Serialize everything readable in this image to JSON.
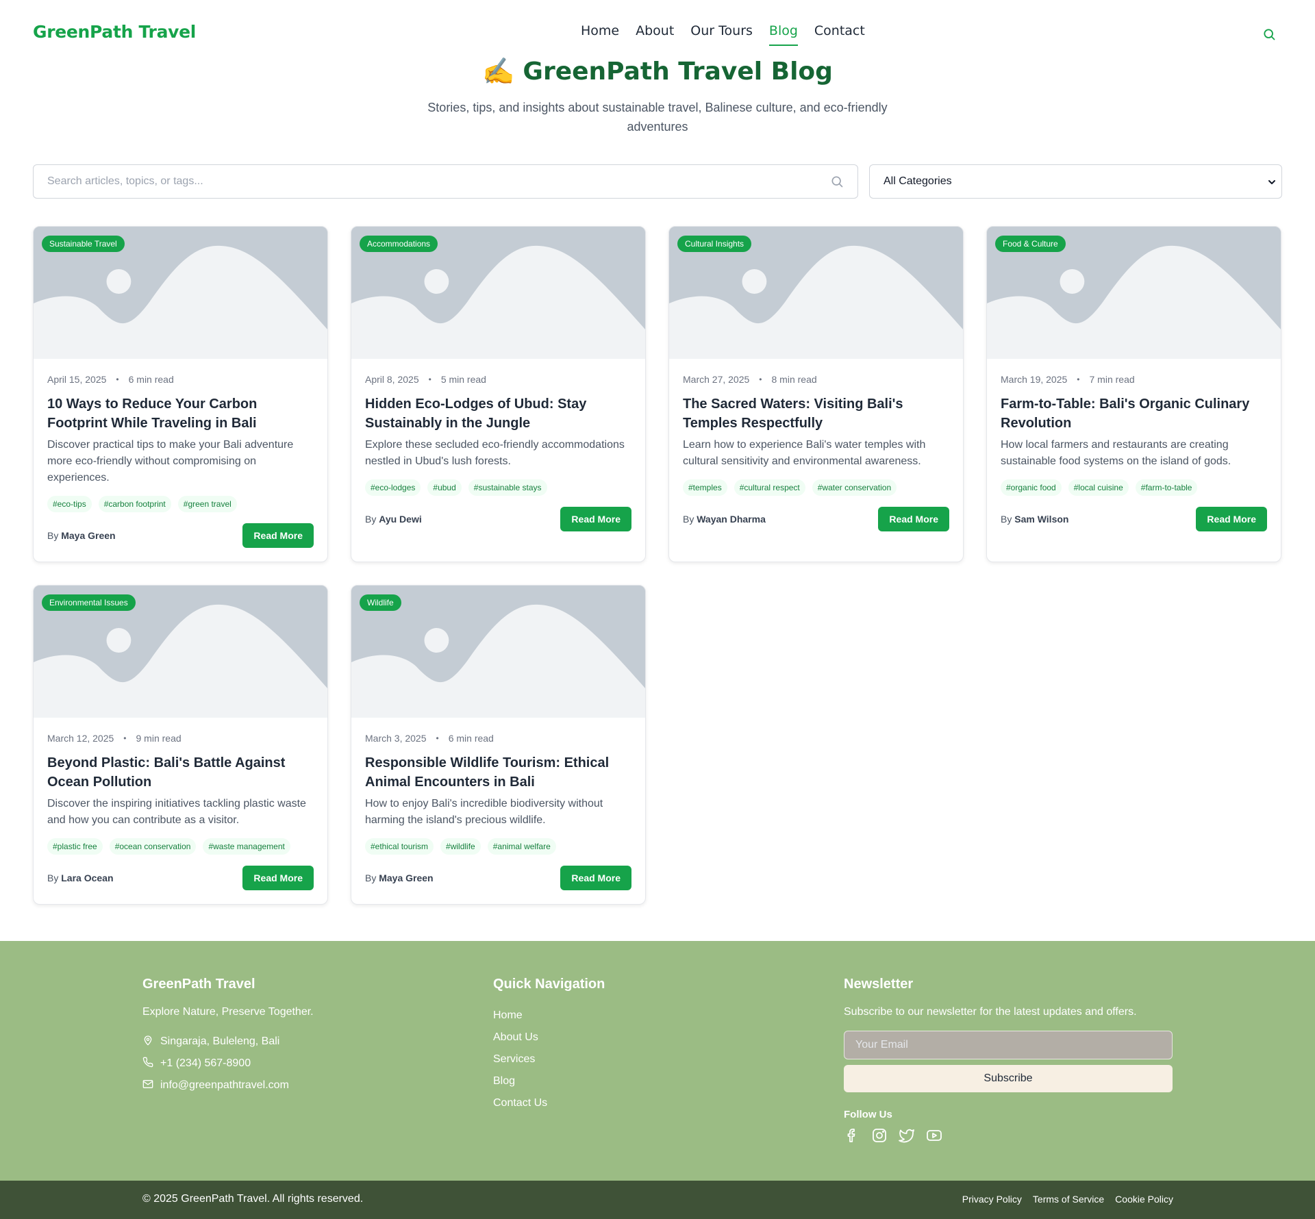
{
  "header": {
    "logo": "GreenPath Travel",
    "nav": [
      "Home",
      "About",
      "Our Tours",
      "Blog",
      "Contact"
    ],
    "active_nav": "Blog"
  },
  "hero": {
    "emoji": "✍️",
    "title": "GreenPath Travel Blog",
    "subtitle": "Stories, tips, and insights about sustainable travel, Balinese culture, and eco-friendly adventures"
  },
  "filters": {
    "search_placeholder": "Search articles, topics, or tags...",
    "category_selected": "All Categories"
  },
  "posts": [
    {
      "category": "Sustainable Travel",
      "date": "April 15, 2025",
      "read_time": "6 min read",
      "title": "10 Ways to Reduce Your Carbon Footprint While Traveling in Bali",
      "excerpt": "Discover practical tips to make your Bali adventure more eco-friendly without compromising on experiences.",
      "tags": [
        "#eco-tips",
        "#carbon footprint",
        "#green travel"
      ],
      "by": "By",
      "author": "Maya Green",
      "cta": "Read More"
    },
    {
      "category": "Accommodations",
      "date": "April 8, 2025",
      "read_time": "5 min read",
      "title": "Hidden Eco-Lodges of Ubud: Stay Sustainably in the Jungle",
      "excerpt": "Explore these secluded eco-friendly accommodations nestled in Ubud's lush forests.",
      "tags": [
        "#eco-lodges",
        "#ubud",
        "#sustainable stays"
      ],
      "by": "By",
      "author": "Ayu Dewi",
      "cta": "Read More"
    },
    {
      "category": "Cultural Insights",
      "date": "March 27, 2025",
      "read_time": "8 min read",
      "title": "The Sacred Waters: Visiting Bali's Temples Respectfully",
      "excerpt": "Learn how to experience Bali's water temples with cultural sensitivity and environmental awareness.",
      "tags": [
        "#temples",
        "#cultural respect",
        "#water conservation"
      ],
      "by": "By",
      "author": "Wayan Dharma",
      "cta": "Read More"
    },
    {
      "category": "Food & Culture",
      "date": "March 19, 2025",
      "read_time": "7 min read",
      "title": "Farm-to-Table: Bali's Organic Culinary Revolution",
      "excerpt": "How local farmers and restaurants are creating sustainable food systems on the island of gods.",
      "tags": [
        "#organic food",
        "#local cuisine",
        "#farm-to-table"
      ],
      "by": "By",
      "author": "Sam Wilson",
      "cta": "Read More"
    },
    {
      "category": "Environmental Issues",
      "date": "March 12, 2025",
      "read_time": "9 min read",
      "title": "Beyond Plastic: Bali's Battle Against Ocean Pollution",
      "excerpt": "Discover the inspiring initiatives tackling plastic waste and how you can contribute as a visitor.",
      "tags": [
        "#plastic free",
        "#ocean conservation",
        "#waste management"
      ],
      "by": "By",
      "author": "Lara Ocean",
      "cta": "Read More"
    },
    {
      "category": "Wildlife",
      "date": "March 3, 2025",
      "read_time": "6 min read",
      "title": "Responsible Wildlife Tourism: Ethical Animal Encounters in Bali",
      "excerpt": "How to enjoy Bali's incredible biodiversity without harming the island's precious wildlife.",
      "tags": [
        "#ethical tourism",
        "#wildlife",
        "#animal welfare"
      ],
      "by": "By",
      "author": "Maya Green",
      "cta": "Read More"
    }
  ],
  "footer": {
    "brand": {
      "title": "GreenPath Travel",
      "tagline": "Explore Nature, Preserve Together.",
      "address": "Singaraja, Buleleng, Bali",
      "phone": "+1 (234) 567-8900",
      "email": "info@greenpathtravel.com"
    },
    "quick_nav": {
      "title": "Quick Navigation",
      "links": [
        "Home",
        "About Us",
        "Services",
        "Blog",
        "Contact Us"
      ]
    },
    "newsletter": {
      "title": "Newsletter",
      "text": "Subscribe to our newsletter for the latest updates and offers.",
      "placeholder": "Your Email",
      "button": "Subscribe",
      "follow": "Follow Us",
      "social_icons": [
        "facebook-icon",
        "instagram-icon",
        "twitter-icon",
        "youtube-icon"
      ]
    },
    "copyright": "© 2025 GreenPath Travel. All rights reserved.",
    "legal_links": [
      "Privacy Policy",
      "Terms of Service",
      "Cookie Policy"
    ]
  },
  "colors": {
    "brand_green": "#16a34a",
    "title_green": "#166534",
    "footer_bg": "#9bbc84",
    "bottombar_bg": "#3f5237"
  }
}
